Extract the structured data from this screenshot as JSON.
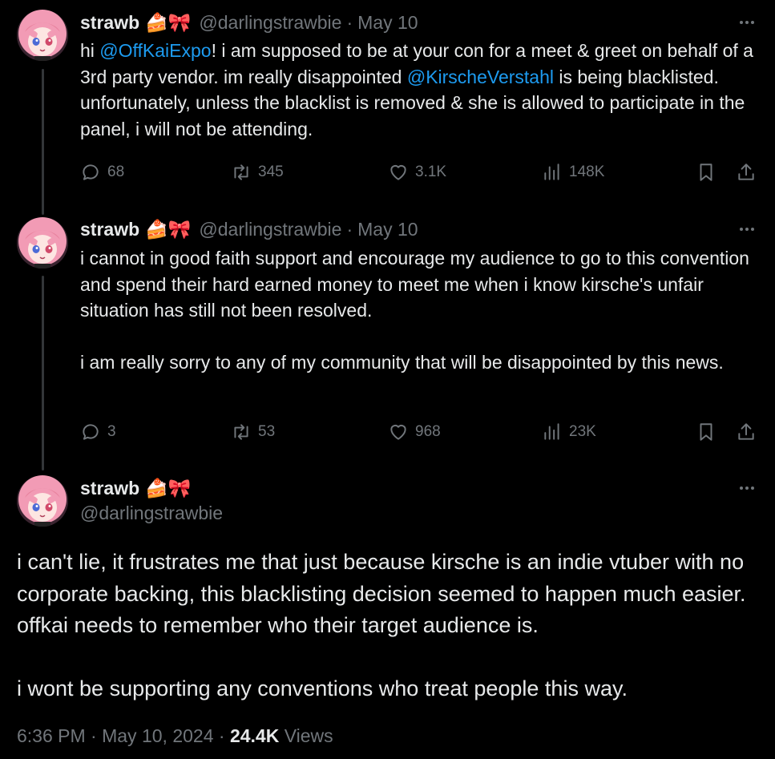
{
  "tweets": [
    {
      "name": "strawb",
      "emoji": "🍰🎀",
      "handle": "@darlingstrawbie",
      "separator": "·",
      "date": "May 10",
      "body_parts": [
        {
          "text": "hi ",
          "mention": false
        },
        {
          "text": "@OffKaiExpo",
          "mention": true
        },
        {
          "text": "! i am supposed to be at your con for a meet & greet on behalf of a 3rd party vendor. im really disappointed ",
          "mention": false
        },
        {
          "text": "@KirscheVerstahl",
          "mention": true
        },
        {
          "text": " is being blacklisted. unfortunately, unless the blacklist is removed & she is allowed to participate in the panel, i will not be attending.",
          "mention": false
        }
      ],
      "replies": "68",
      "reposts": "345",
      "likes": "3.1K",
      "views": "148K"
    },
    {
      "name": "strawb",
      "emoji": "🍰🎀",
      "handle": "@darlingstrawbie",
      "separator": "·",
      "date": "May 10",
      "body": "i cannot in good faith support and encourage my audience to go to this convention and spend their hard earned money to meet me when i know kirsche's unfair situation has still not been resolved.\n\ni am really sorry to any of my community that will be disappointed by this news.",
      "replies": "3",
      "reposts": "53",
      "likes": "968",
      "views": "23K"
    }
  ],
  "main": {
    "name": "strawb",
    "emoji": "🍰🎀",
    "handle": "@darlingstrawbie",
    "body": "i can't lie, it frustrates me that just because kirsche is an indie vtuber with no corporate backing, this blacklisting decision seemed to happen much easier. offkai needs to remember who their target audience is.\n\ni wont be supporting any conventions who treat people this way.",
    "time": "6:36 PM",
    "separator": "·",
    "date": "May 10, 2024",
    "views_count": "24.4K",
    "views_label": "Views"
  },
  "icons": {
    "reply": "reply-icon",
    "repost": "repost-icon",
    "like": "heart-icon",
    "views": "analytics-icon",
    "bookmark": "bookmark-icon",
    "share": "share-icon",
    "more": "more-icon"
  },
  "colors": {
    "background": "#000000",
    "text": "#e7e9ea",
    "muted": "#71767b",
    "mention": "#1d9bf0"
  }
}
